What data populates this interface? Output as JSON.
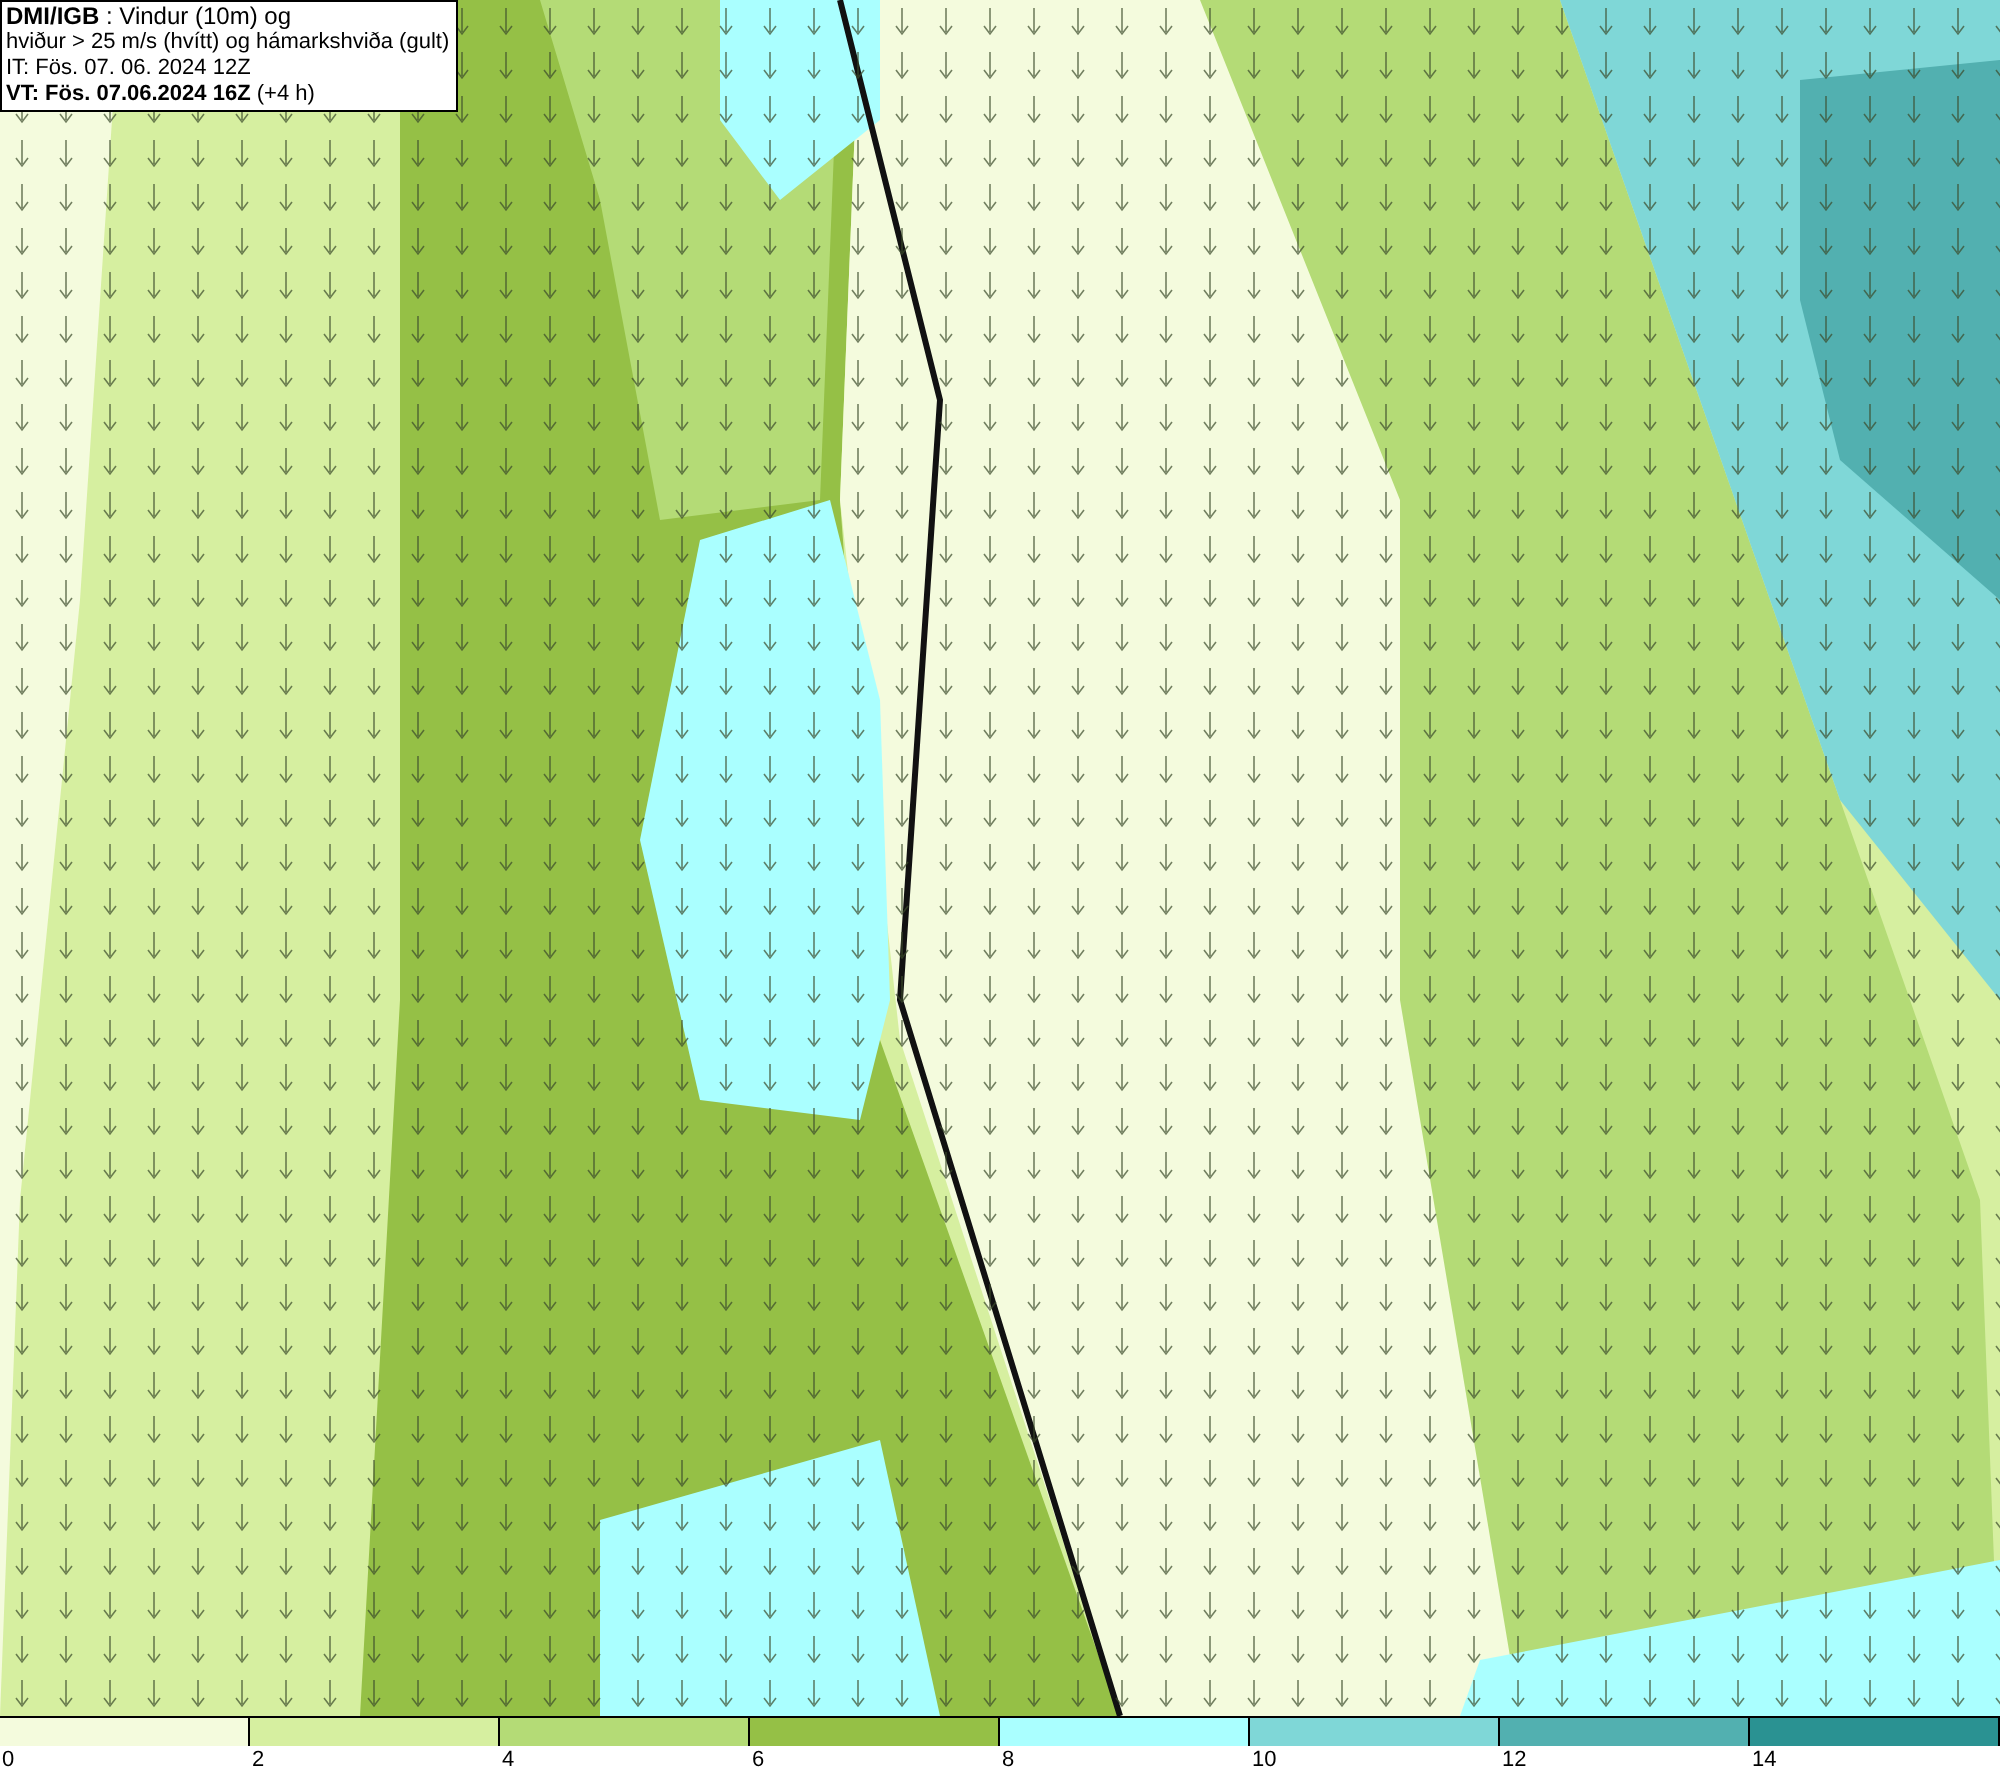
{
  "info_box": {
    "lines": [
      "**DMI/IGB** : Vindur (10m) og",
      "hviður > 25 m/s (hvítt) og hámarkshviða (gult)",
      "IT: Fös. 07. 06. 2024 12Z",
      "**VT: Fös. 07.06.2024 16Z** (+4 h)"
    ]
  },
  "legend": {
    "segments": [
      {
        "color": "#f4fbdd",
        "label": "0"
      },
      {
        "color": "#d6efa0",
        "label": "2"
      },
      {
        "color": "#b4db76",
        "label": "4"
      },
      {
        "color": "#95c046",
        "label": "6"
      },
      {
        "color": "#aaffff",
        "label": "8"
      },
      {
        "color": "#7fd7d7",
        "label": "10"
      },
      {
        "color": "#52b0b0",
        "label": "12"
      },
      {
        "color": "#2a9292",
        "label": "14"
      }
    ]
  }
}
